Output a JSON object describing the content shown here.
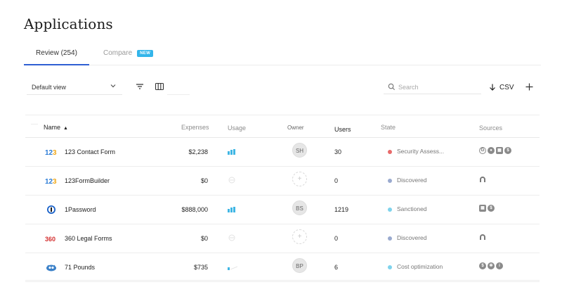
{
  "page": {
    "title": "Applications"
  },
  "tabs": [
    {
      "label": "Review (254)",
      "active": true
    },
    {
      "label": "Compare",
      "badge": "NEW",
      "active": false
    }
  ],
  "toolbar": {
    "view_select": "Default view",
    "search_placeholder": "Search",
    "csv_label": "CSV"
  },
  "table": {
    "columns": [
      "Name",
      "Expenses",
      "Usage",
      "Owner",
      "Users",
      "State",
      "Sources"
    ],
    "sort_indicator": "▲",
    "rows": [
      {
        "name": "123 Contact Form",
        "expenses": "$2,238",
        "owner": "SH",
        "users": "30",
        "state": "Security Assess...",
        "state_color": "#e86a6a",
        "usage": "bars",
        "logo": "123",
        "sources": [
          "google-icon",
          "circle-icon",
          "app-icon",
          "dollar-icon"
        ]
      },
      {
        "name": "123FormBuilder",
        "expenses": "$0",
        "owner": "+",
        "users": "0",
        "state": "Discovered",
        "state_color": "#9aaacf",
        "usage": "empty",
        "logo": "123",
        "sources": [
          "arch-icon"
        ]
      },
      {
        "name": "1Password",
        "expenses": "$888,000",
        "owner": "BS",
        "users": "1219",
        "state": "Sanctioned",
        "state_color": "#7fd3ec",
        "usage": "bars",
        "logo": "1password",
        "sources": [
          "app-icon",
          "dollar-icon"
        ]
      },
      {
        "name": "360 Legal Forms",
        "expenses": "$0",
        "owner": "+",
        "users": "0",
        "state": "Discovered",
        "state_color": "#9aaacf",
        "usage": "empty",
        "logo": "360",
        "sources": [
          "arch-icon"
        ]
      },
      {
        "name": "71 Pounds",
        "expenses": "$735",
        "owner": "BP",
        "users": "6",
        "state": "Cost optimization",
        "state_color": "#7fd3ec",
        "usage": "low",
        "logo": "71pounds",
        "sources": [
          "dollar-icon",
          "slack-icon",
          "info-icon"
        ]
      }
    ]
  },
  "colors": {
    "accent": "#2f5fd3",
    "badge": "#33b5ea",
    "usage": "#3fb6e4"
  }
}
